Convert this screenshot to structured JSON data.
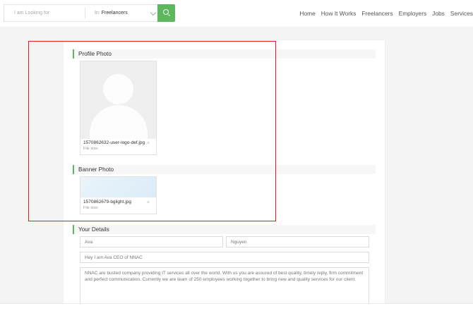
{
  "search": {
    "placeholder": "I am Looking for",
    "category_prefix": "In:",
    "category_value": "Freelancers"
  },
  "nav": {
    "items": [
      "Home",
      "How It Works",
      "Freelancers",
      "Employers",
      "Jobs",
      "Services"
    ]
  },
  "profile_photo": {
    "heading": "Profile Photo",
    "file_name": "1570862632-user-logo-def.jpg",
    "file_size": "File size:",
    "remove": "×"
  },
  "banner_photo": {
    "heading": "Banner Photo",
    "file_name": "1570862679-bglight.jpg",
    "file_size": "File size:",
    "remove": "×"
  },
  "details": {
    "heading": "Your Details",
    "first_name": "Ava",
    "last_name": "Nguyen",
    "tagline": "Hey I am Ava CEO of NNAC",
    "description": "NNAC are busted company providing IT services all over the world. With us you are assured of best quality, timely reply, firm commitment and perfect communication. Currently we are team of 250 employees working together to bring new and quality services for our client."
  },
  "colors": {
    "accent": "#5cb85c",
    "highlight": "#e21b1b"
  }
}
